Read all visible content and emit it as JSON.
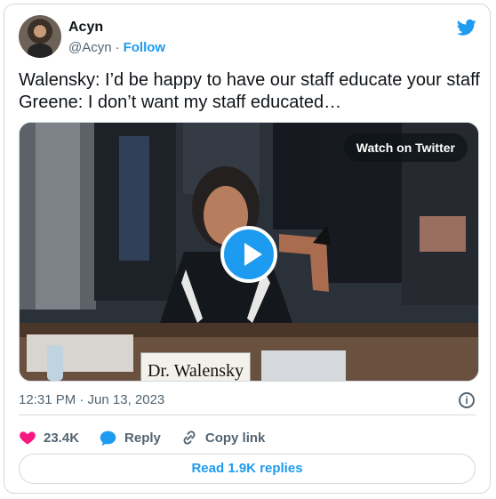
{
  "author": {
    "name": "Acyn",
    "handle": "@Acyn",
    "separator": "·",
    "follow_label": "Follow"
  },
  "tweet": {
    "text": "Walensky: I’d be happy to have our staff educate your staff\nGreene: I don’t want my staff educated…",
    "timestamp": "12:31 PM · Jun 13, 2023"
  },
  "media": {
    "watch_label": "Watch on Twitter",
    "nameplate": "Dr. Walensky"
  },
  "actions": {
    "like_count": "23.4K",
    "reply_label": "Reply",
    "copy_label": "Copy link",
    "read_replies_label": "Read 1.9K replies"
  },
  "colors": {
    "accent": "#1d9bf0",
    "like": "#f91880",
    "text": "#0f1419",
    "secondary": "#536471",
    "border": "#cfd9de"
  },
  "icons": [
    "twitter-bird-icon",
    "play-icon",
    "info-icon",
    "heart-icon",
    "reply-bubble-icon",
    "link-icon"
  ]
}
